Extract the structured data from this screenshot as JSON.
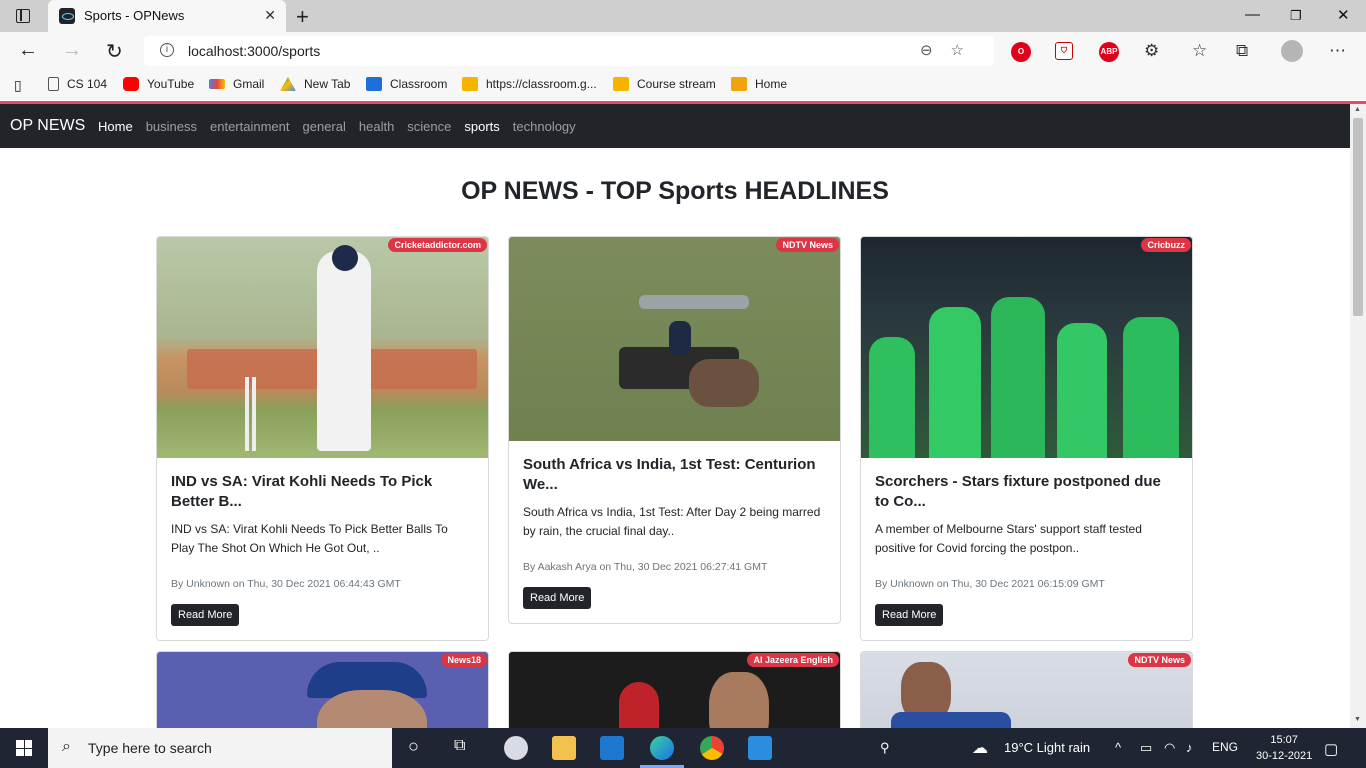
{
  "browser": {
    "tab_title": "Sports - OPNews",
    "url": "localhost:3000/sports",
    "bookmarks": [
      "CS 104",
      "YouTube",
      "Gmail",
      "New Tab",
      "Classroom",
      "https://classroom.g...",
      "Course stream",
      "Home"
    ]
  },
  "site": {
    "brand": "OP NEWS",
    "nav": [
      "Home",
      "business",
      "entertainment",
      "general",
      "health",
      "science",
      "sports",
      "technology"
    ],
    "headline": "OP NEWS - TOP Sports HEADLINES",
    "read_more": "Read More"
  },
  "articles": [
    {
      "source": "Cricketaddictor.com",
      "title": "IND vs SA: Virat Kohli Needs To Pick Better B...",
      "description": "IND vs SA: Virat Kohli Needs To Pick Better Balls To Play The Shot On Which He Got Out, ..",
      "meta": "By Unknown on Thu, 30 Dec 2021 06:44:43 GMT"
    },
    {
      "source": "NDTV News",
      "title": "South Africa vs India, 1st Test: Centurion We...",
      "description": "South Africa vs India, 1st Test: After Day 2 being marred by rain, the crucial final day..",
      "meta": "By Aakash Arya on Thu, 30 Dec 2021 06:27:41 GMT"
    },
    {
      "source": "Cricbuzz",
      "title": "Scorchers - Stars fixture postponed due to Co...",
      "description": "A member of Melbourne Stars' support staff tested positive for Covid forcing the postpon..",
      "meta": "By Unknown on Thu, 30 Dec 2021 06:15:09 GMT"
    },
    {
      "source": "News18"
    },
    {
      "source": "Al Jazeera English"
    },
    {
      "source": "NDTV News"
    }
  ],
  "taskbar": {
    "search_placeholder": "Type here to search",
    "weather": "19°C  Light rain",
    "language": "ENG",
    "time": "15:07",
    "date": "30-12-2021"
  }
}
